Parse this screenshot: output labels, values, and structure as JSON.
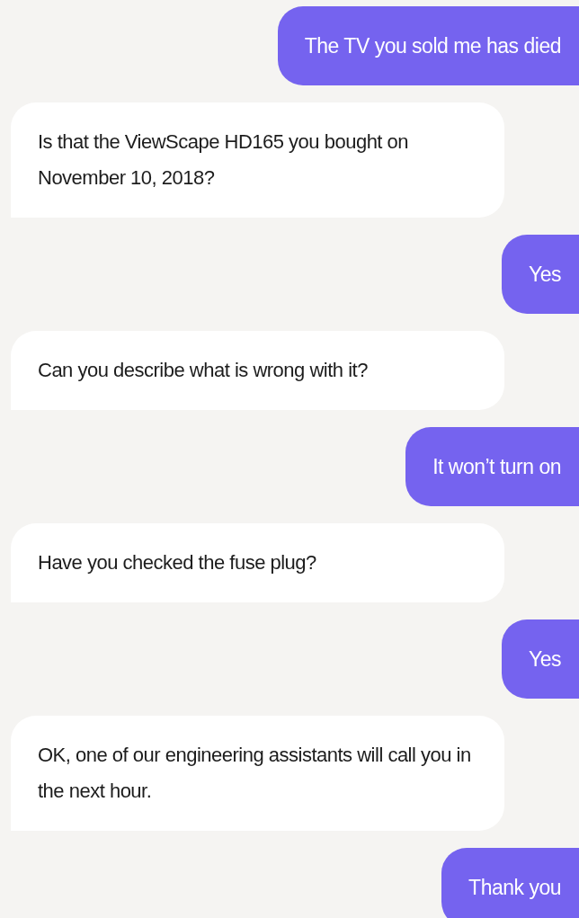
{
  "messages": [
    {
      "kind": "user",
      "text": "The TV you sold me has died"
    },
    {
      "kind": "bot",
      "text": "Is that the ViewScape HD165 you bought on November 10, 2018?"
    },
    {
      "kind": "user",
      "text": "Yes"
    },
    {
      "kind": "bot",
      "text": "Can you describe what is wrong with it?"
    },
    {
      "kind": "user",
      "text": "It won’t turn on"
    },
    {
      "kind": "bot",
      "text": "Have you checked the fuse plug?"
    },
    {
      "kind": "user",
      "text": "Yes"
    },
    {
      "kind": "bot",
      "text": "OK, one of our engineering assistants will call you in the next hour."
    },
    {
      "kind": "user",
      "text": "Thank you"
    }
  ]
}
